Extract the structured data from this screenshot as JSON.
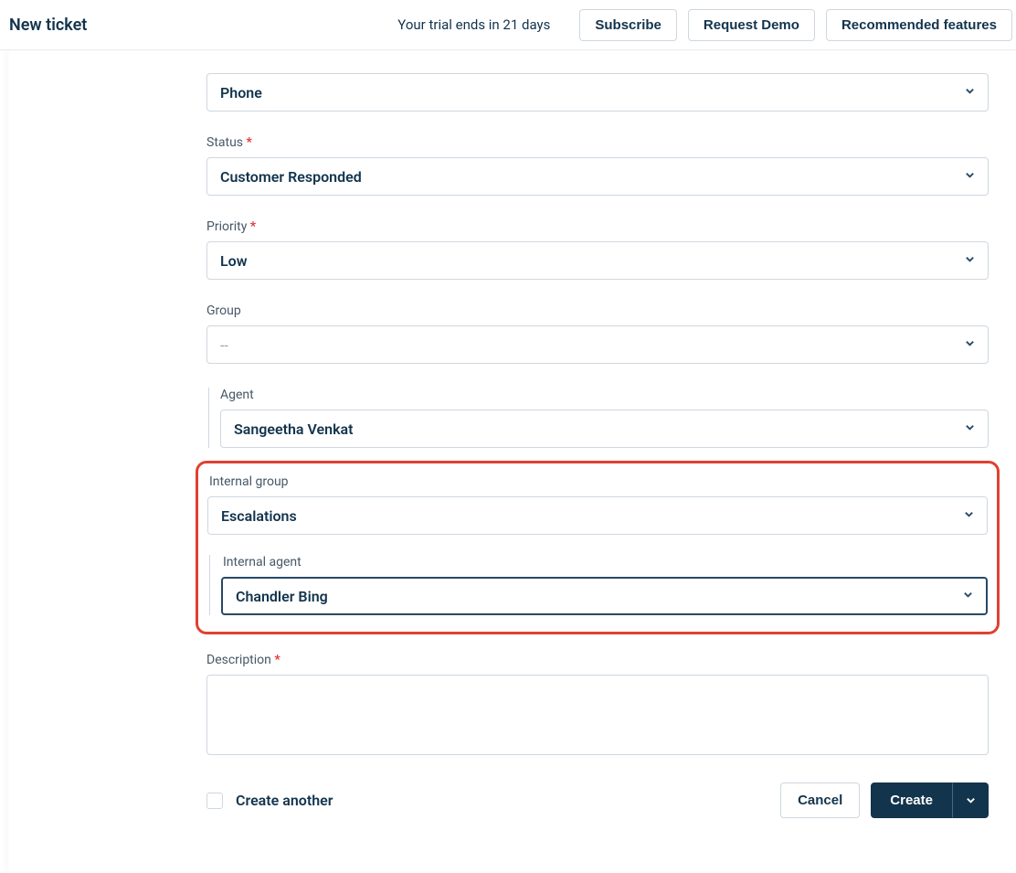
{
  "header": {
    "title": "New ticket",
    "trial_text": "Your trial ends in 21 days",
    "subscribe_label": "Subscribe",
    "request_demo_label": "Request Demo",
    "recommended_label": "Recommended features"
  },
  "fields": {
    "source": {
      "value": "Phone"
    },
    "status": {
      "label": "Status",
      "value": "Customer Responded"
    },
    "priority": {
      "label": "Priority",
      "value": "Low"
    },
    "group": {
      "label": "Group",
      "value": "--"
    },
    "agent": {
      "label": "Agent",
      "value": "Sangeetha Venkat"
    },
    "internal_group": {
      "label": "Internal group",
      "value": "Escalations"
    },
    "internal_agent": {
      "label": "Internal agent",
      "value": "Chandler Bing"
    },
    "description": {
      "label": "Description",
      "value": ""
    }
  },
  "footer": {
    "create_another_label": "Create another",
    "cancel_label": "Cancel",
    "create_label": "Create"
  }
}
